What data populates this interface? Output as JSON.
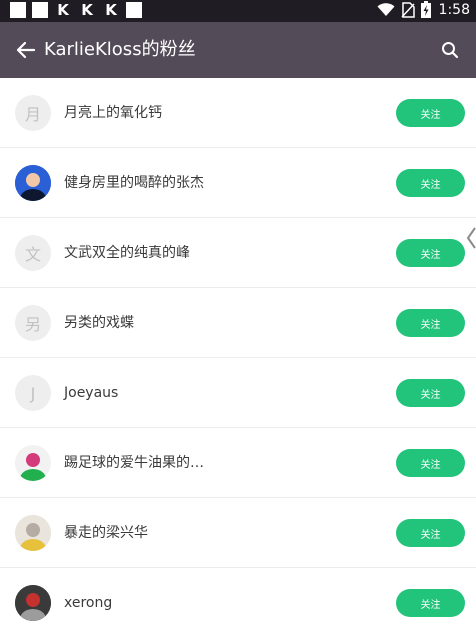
{
  "status_bar": {
    "time": "1:58"
  },
  "app_bar": {
    "title": "KarlieKloss的粉丝"
  },
  "follow_label": "关注",
  "users": [
    {
      "name": "月亮上的氧化钙",
      "avatar": {
        "type": "letter",
        "text": "月"
      }
    },
    {
      "name": "健身房里的喝醉的张杰",
      "avatar": {
        "type": "photo",
        "palette": [
          "#2a5fd6",
          "#0e1730",
          "#f1c7a7"
        ]
      }
    },
    {
      "name": "文武双全的纯真的峰",
      "avatar": {
        "type": "letter",
        "text": "文"
      }
    },
    {
      "name": "另类的戏蝶",
      "avatar": {
        "type": "letter",
        "text": "另"
      }
    },
    {
      "name": "Joeyaus",
      "avatar": {
        "type": "letter",
        "text": "J"
      }
    },
    {
      "name": "踢足球的爱牛油果的…",
      "avatar": {
        "type": "photo",
        "palette": [
          "#f2f2f2",
          "#22b04f",
          "#d43b7a"
        ]
      }
    },
    {
      "name": "暴走的梁兴华",
      "avatar": {
        "type": "photo",
        "palette": [
          "#e9e4dc",
          "#e7c13c",
          "#b5aca4"
        ]
      }
    },
    {
      "name": "xerong",
      "avatar": {
        "type": "photo",
        "palette": [
          "#3a3a3a",
          "#9c9c9c",
          "#c4312e"
        ]
      }
    }
  ],
  "icons": {
    "back": "arrow-left-icon",
    "search": "search-icon"
  },
  "colors": {
    "app_bar": "#544b59",
    "status_bar": "#1f1c23",
    "follow_button": "#22c47c",
    "avatar_placeholder": "#eeeeee"
  }
}
